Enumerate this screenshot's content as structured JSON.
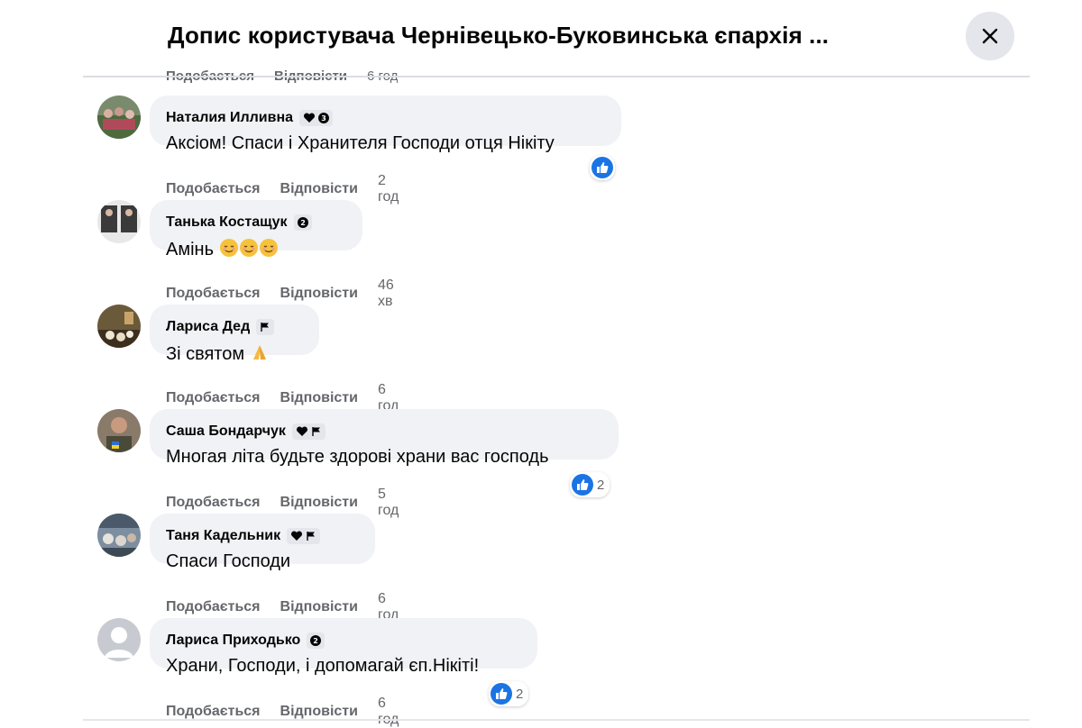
{
  "header": {
    "title": "Допис користувача Чернівецько-Буковинська єпархія ..."
  },
  "labels": {
    "like": "Подобається",
    "reply": "Відповісти"
  },
  "partial": {
    "time": "6 год"
  },
  "comments": [
    {
      "name": "Наталия Илливна",
      "text": "Аксіом! Спаси і Хранителя Господи отця Нікіту",
      "time": "2 год",
      "reactions": null
    },
    {
      "name": "Танька Костащук",
      "text": "Амінь",
      "time": "46 хв",
      "reactions": null
    },
    {
      "name": "Лариса Дед",
      "text": "Зі святом",
      "time": "6 год",
      "reactions": null
    },
    {
      "name": "Саша Бондарчук",
      "text": "Многая літа будьте здорові храни вас господь",
      "time": "5 год",
      "reactions": "2"
    },
    {
      "name": "Таня Кадельник",
      "text": "Спаси Господи",
      "time": "6 год",
      "reactions": null
    },
    {
      "name": "Лариса Приходько",
      "text": "Храни, Господи, і допомагай єп.Нікіті!",
      "time": "6 год",
      "reactions": "2"
    }
  ],
  "colors": {
    "bubble": "#f0f2f5",
    "like": "#1b74e4",
    "muted": "#65676b"
  },
  "icons": {
    "close": "close-icon",
    "like": "like-icon",
    "heart_badge": "heart-badge-icon",
    "flag_badge": "flag-badge-icon",
    "rank_badge": "rank-badge-icon"
  }
}
